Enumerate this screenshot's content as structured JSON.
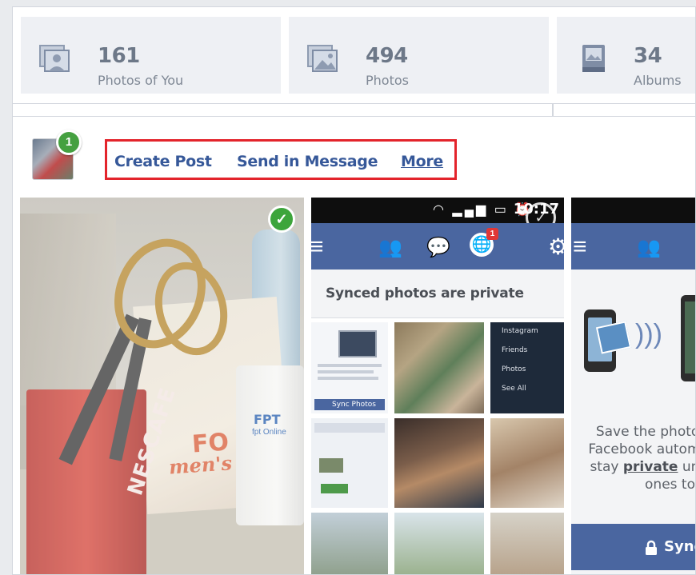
{
  "stats": [
    {
      "count": "161",
      "label": "Photos of You",
      "icon": "photos-of-you-icon"
    },
    {
      "count": "494",
      "label": "Photos",
      "icon": "photos-icon"
    },
    {
      "count": "34",
      "label": "Albums",
      "icon": "albums-icon"
    }
  ],
  "badge_count": "1",
  "actions": {
    "create_post": "Create Post",
    "send_in_message": "Send in Message",
    "more": "More"
  },
  "phone": {
    "time": "10:17",
    "notification_count": "1",
    "synced_heading": "Synced photos are private",
    "menu_instagram": "Instagram",
    "menu_friends": "Friends",
    "menu_photos": "Photos",
    "menu_see_all": "See All",
    "sync_photos_small": "Sync Photos"
  },
  "sync_screen": {
    "line1": "Save the photos",
    "line2": "Facebook automat",
    "line3_prefix": "stay ",
    "line3_bold": "private",
    "line3_suffix": " until",
    "line4": "ones to",
    "button": "Sync"
  },
  "photo1": {
    "brand": "NESCAFE",
    "poster_1": "FO",
    "poster_2": "men's day",
    "mug_brand": "FPT",
    "mug_sub": "fpt Online"
  },
  "colors": {
    "link": "#365899",
    "highlight_border": "#e3242b",
    "check_green": "#3da53b",
    "fb_blue": "#4a66a0"
  }
}
